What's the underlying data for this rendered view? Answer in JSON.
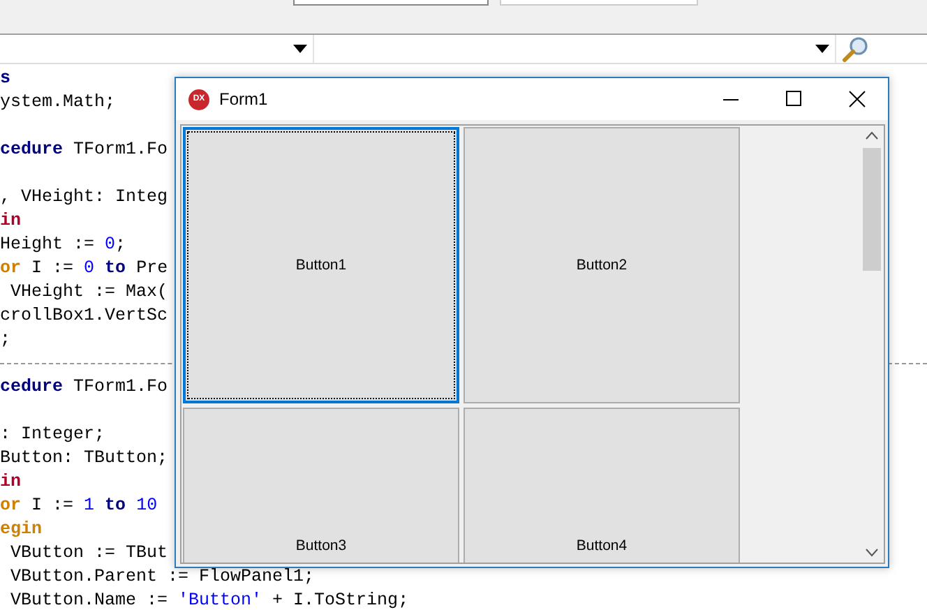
{
  "combo_boxes": [
    {
      "kind": "dropdown"
    },
    {
      "kind": "dropdown"
    }
  ],
  "code_lines": [
    {
      "kind": "code",
      "segments": [
        {
          "kind": "keyword",
          "text": "s"
        }
      ]
    },
    {
      "kind": "code",
      "segments": [
        {
          "kind": "plain",
          "text": "ystem.Math;"
        }
      ]
    },
    {
      "kind": "blank"
    },
    {
      "kind": "code",
      "segments": [
        {
          "kind": "keyword",
          "text": "cedure"
        },
        {
          "kind": "plain",
          "text": " TForm1.Fo"
        }
      ]
    },
    {
      "kind": "blank"
    },
    {
      "kind": "code",
      "segments": [
        {
          "kind": "plain",
          "text": ", VHeight: Integ"
        }
      ]
    },
    {
      "kind": "code",
      "segments": [
        {
          "kind": "begin",
          "text": "in"
        }
      ]
    },
    {
      "kind": "code",
      "segments": [
        {
          "kind": "plain",
          "text": "Height := "
        },
        {
          "kind": "number",
          "text": "0"
        },
        {
          "kind": "plain",
          "text": ";"
        }
      ]
    },
    {
      "kind": "code",
      "segments": [
        {
          "kind": "flow",
          "text": "or"
        },
        {
          "kind": "plain",
          "text": " I := "
        },
        {
          "kind": "number",
          "text": "0"
        },
        {
          "kind": "keyword",
          "text": " to"
        },
        {
          "kind": "plain",
          "text": " Pre"
        }
      ]
    },
    {
      "kind": "code",
      "segments": [
        {
          "kind": "plain",
          "text": " VHeight := Max("
        }
      ]
    },
    {
      "kind": "code",
      "segments": [
        {
          "kind": "plain",
          "text": "crollBox1.VertSc"
        }
      ]
    },
    {
      "kind": "code",
      "segments": [
        {
          "kind": "plain",
          "text": ";"
        }
      ]
    },
    {
      "kind": "separator"
    },
    {
      "kind": "code",
      "segments": [
        {
          "kind": "keyword",
          "text": "cedure"
        },
        {
          "kind": "plain",
          "text": " TForm1.Fo"
        }
      ]
    },
    {
      "kind": "blank"
    },
    {
      "kind": "code",
      "segments": [
        {
          "kind": "plain",
          "text": ": Integer;"
        }
      ]
    },
    {
      "kind": "code",
      "segments": [
        {
          "kind": "plain",
          "text": "Button: TButton;"
        }
      ]
    },
    {
      "kind": "code",
      "segments": [
        {
          "kind": "begin",
          "text": "in"
        }
      ]
    },
    {
      "kind": "code",
      "segments": [
        {
          "kind": "flow",
          "text": "or"
        },
        {
          "kind": "plain",
          "text": " I := "
        },
        {
          "kind": "number",
          "text": "1"
        },
        {
          "kind": "keyword",
          "text": " to"
        },
        {
          "kind": "number",
          "text": " 10"
        }
      ]
    },
    {
      "kind": "code",
      "segments": [
        {
          "kind": "flow",
          "text": "egin"
        }
      ]
    },
    {
      "kind": "code",
      "segments": [
        {
          "kind": "plain",
          "text": " VButton := TBut"
        }
      ]
    },
    {
      "kind": "code",
      "segments": [
        {
          "kind": "plain",
          "text": " VButton.Parent := FlowPanel1;"
        }
      ]
    },
    {
      "kind": "code",
      "segments": [
        {
          "kind": "plain",
          "text": " VButton.Name := "
        },
        {
          "kind": "string",
          "text": "'Button'"
        },
        {
          "kind": "plain",
          "text": " + I.ToString;"
        }
      ]
    }
  ],
  "form": {
    "icon_text": "DX",
    "title": "Form1",
    "buttons": [
      {
        "label": "Button1",
        "focused": true
      },
      {
        "label": "Button2",
        "focused": false
      },
      {
        "label": "Button3",
        "focused": false
      },
      {
        "label": "Button4",
        "focused": false
      }
    ]
  }
}
